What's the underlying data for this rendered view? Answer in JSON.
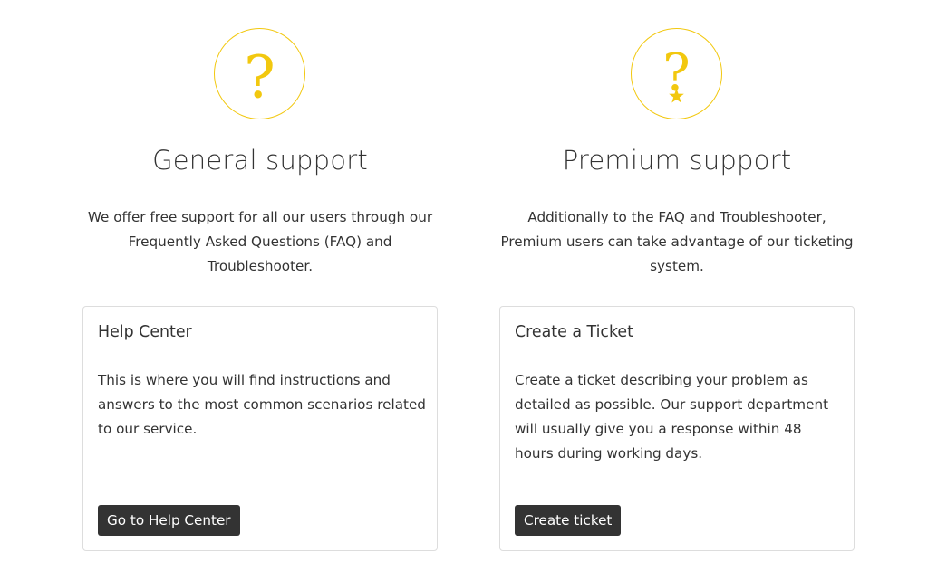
{
  "colors": {
    "accent": "#f2c80f",
    "text": "#333333",
    "button_bg": "#333333",
    "button_text": "#ffffff",
    "card_border": "#dddddd"
  },
  "general": {
    "icon": "question-mark-icon",
    "title": "General support",
    "intro": "We offer free support for all our users through our Frequently Asked Questions (FAQ) and Troubleshooter.",
    "card": {
      "title": "Help Center",
      "body": "This is where you will find instructions and answers to the most common scenarios related to our service.",
      "button": "Go to Help Center"
    }
  },
  "premium": {
    "icon": "question-star-icon",
    "title": "Premium support",
    "intro": "Additionally to the FAQ and Troubleshooter, Premium users can take advantage of our ticketing system.",
    "card": {
      "title": "Create a Ticket",
      "body": "Create a ticket describing your problem as detailed as possible. Our support department will usually give you a response within 48 hours during working days.",
      "button": "Create ticket"
    }
  }
}
